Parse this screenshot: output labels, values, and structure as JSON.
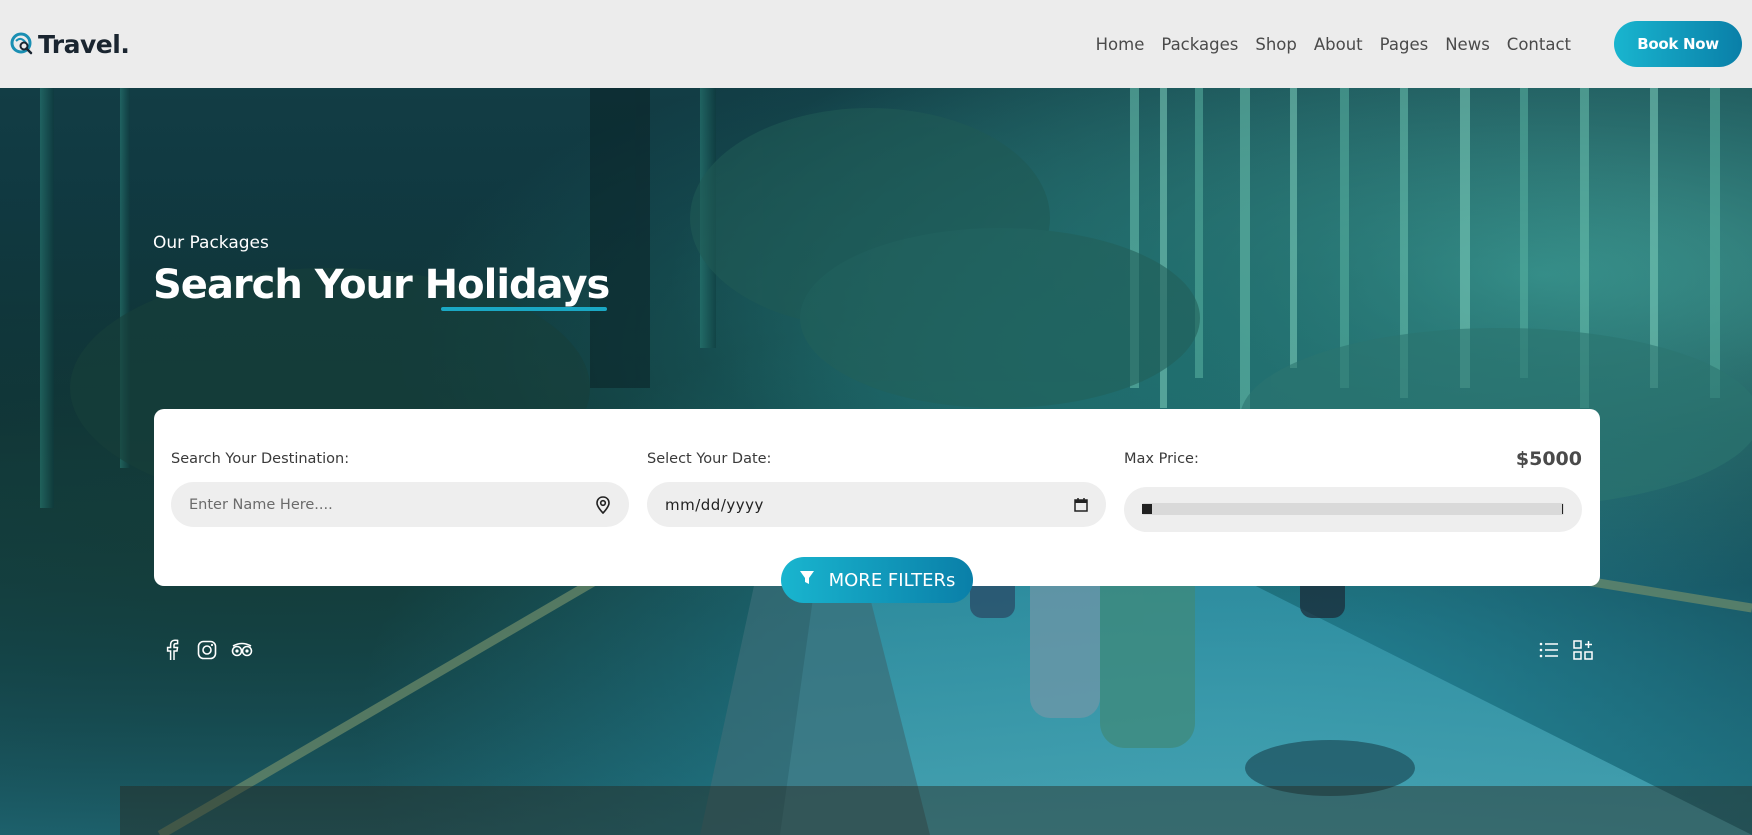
{
  "brand": {
    "name": "Travel."
  },
  "nav": {
    "items": [
      "Home",
      "Packages",
      "Shop",
      "About",
      "Pages",
      "News",
      "Contact"
    ],
    "cta_label": "Book Now"
  },
  "hero": {
    "eyebrow": "Our Packages",
    "title": "Search Your Holidays"
  },
  "search": {
    "destination_label": "Search Your Destination:",
    "destination_placeholder": "Enter Name Here....",
    "date_label": "Select Your Date:",
    "date_value": "mm/dd/yyyy",
    "price_label": "Max Price:",
    "price_value": "$5000",
    "price_level_fraction": 0.0,
    "filters_label": "MORE FILTERs"
  },
  "socials": [
    "facebook-icon",
    "instagram-icon",
    "tripadvisor-icon"
  ],
  "view_toggles": [
    "list-view-icon",
    "grid-view-icon"
  ],
  "colors": {
    "accent_start": "#19b5cf",
    "accent_end": "#0a7fa8",
    "header_bg": "#ececec",
    "text_dark": "#1a2530"
  }
}
